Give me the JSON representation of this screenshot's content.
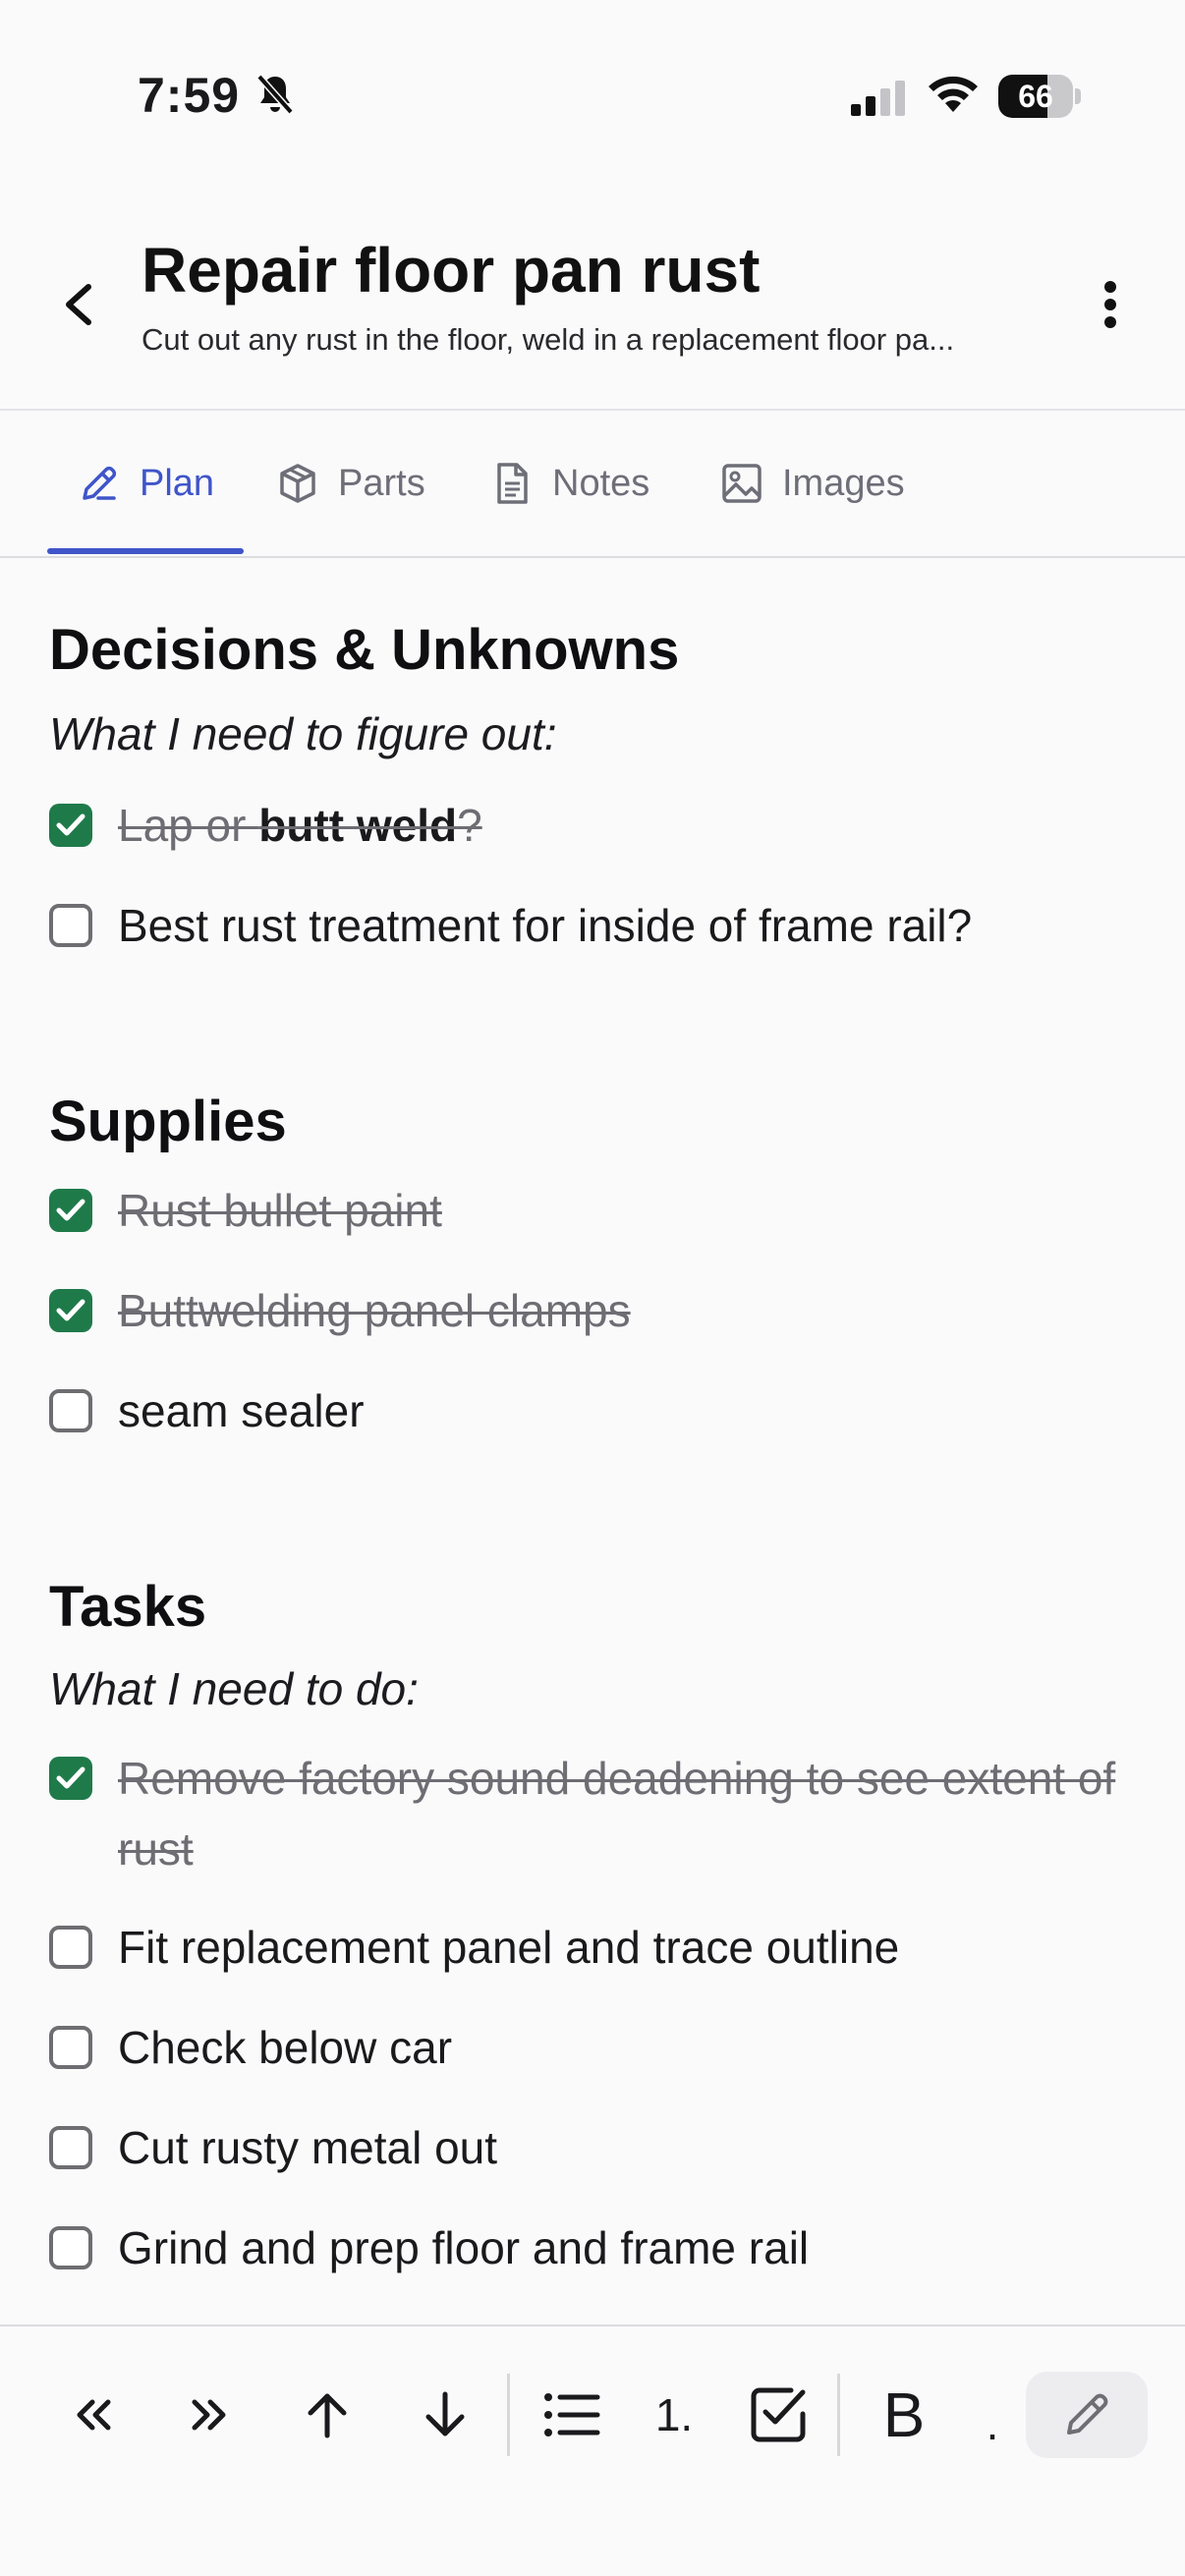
{
  "status_bar": {
    "time": "7:59",
    "battery_percent": 66,
    "battery_label": "66"
  },
  "header": {
    "title": "Repair floor pan rust",
    "subtitle": "Cut out any rust in the floor, weld in a replacement floor pa..."
  },
  "tabs": [
    {
      "label": "Plan",
      "icon": "pencil-icon",
      "active": true
    },
    {
      "label": "Parts",
      "icon": "box-icon",
      "active": false
    },
    {
      "label": "Notes",
      "icon": "document-icon",
      "active": false
    },
    {
      "label": "Images",
      "icon": "image-icon",
      "active": false
    }
  ],
  "sections": {
    "decisions": {
      "title": "Decisions & Unknowns",
      "intro": "What I need to figure out:",
      "items": [
        {
          "text_a": "Lap or ",
          "text_b": "butt weld",
          "text_c": "?",
          "checked": true
        },
        {
          "text": "Best rust treatment for inside of frame rail?",
          "checked": false
        }
      ]
    },
    "supplies": {
      "title": "Supplies",
      "items": [
        {
          "text": "Rust bullet paint",
          "checked": true
        },
        {
          "text": "Buttwelding panel clamps",
          "checked": true
        },
        {
          "text": "seam sealer",
          "checked": false
        }
      ]
    },
    "tasks": {
      "title": "Tasks",
      "intro": "What I need to do:",
      "items": [
        {
          "text": "Remove factory sound deadening to see extent of rust",
          "checked": true
        },
        {
          "text": "Fit replacement panel and trace outline",
          "checked": false
        },
        {
          "text": "Check below car",
          "checked": false
        },
        {
          "text": "Cut rusty metal out",
          "checked": false
        },
        {
          "text": "Grind and prep floor and frame rail",
          "checked": false
        }
      ]
    }
  },
  "toolbar": {
    "outdent_icon": "double-chevron-left-icon",
    "indent_icon": "double-chevron-right-icon",
    "move_up_icon": "arrow-up-icon",
    "move_down_icon": "arrow-down-icon",
    "bullet_list_icon": "bullet-list-icon",
    "numbered_label": "1.",
    "checklist_icon": "checkbox-icon",
    "bold_label": "B",
    "more_label": ".",
    "edit_icon": "pencil-icon"
  },
  "colors": {
    "accent": "#3f55c9",
    "checked": "#1f7a4a"
  }
}
